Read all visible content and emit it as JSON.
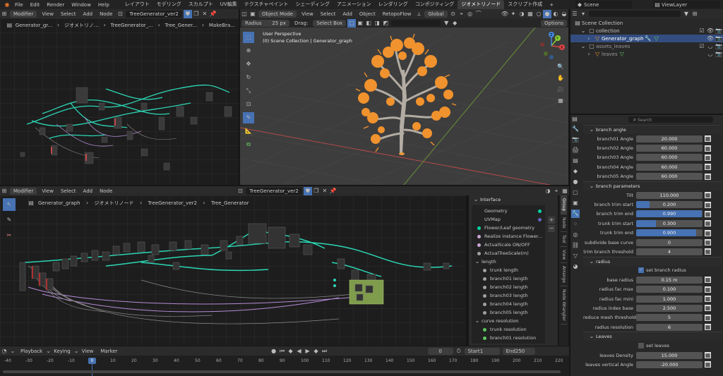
{
  "topbar": {
    "menus": [
      "File",
      "Edit",
      "Render",
      "Window",
      "Help"
    ],
    "workspaces": [
      "レイアウト",
      "モデリング",
      "スカルプト",
      "UV編集",
      "テクスチャペイント",
      "シェーディング",
      "アニメーション",
      "レンダリング",
      "コンポジティング",
      "ジオメトリノード",
      "スクリプト作成"
    ],
    "active_workspace": "ジオメトリノード",
    "add_tab": "+",
    "scene": "Scene",
    "view_layer": "ViewLayer"
  },
  "node_editor_top": {
    "mode": "Modifier",
    "menus": [
      "View",
      "Select",
      "Add",
      "Node"
    ],
    "tree_name": "TreeGenerator_ver2",
    "breadcrumb": [
      "Generator_gr...",
      "ジオメトリノ...",
      "TreeGenerator_...",
      "Tree_Gener...",
      "MakeBra..."
    ]
  },
  "viewport": {
    "mode": "Object Mode",
    "menus": [
      "View",
      "Select",
      "Add",
      "Object",
      "RetopoFlow"
    ],
    "transform": "Global",
    "radius_label": "Radius",
    "radius_value": "25 px",
    "drag_label": "Drag:",
    "drag_value": "Select Box",
    "options": "Options",
    "perspective": "User Perspective",
    "collection_info": "(0) Scene Collection | Generator_graph",
    "axis_x": "X",
    "axis_y": "Y",
    "axis_z": "Z"
  },
  "node_editor_main": {
    "mode": "Modifier",
    "menus": [
      "View",
      "Select",
      "Add",
      "Node"
    ],
    "tree_name": "TreeGenerator_ver2",
    "breadcrumb": [
      "Generator_graph",
      "ジオメトリノード",
      "TreeGenerator_ver2",
      "Tree_Generator"
    ]
  },
  "interface_panel": {
    "title": "Interface",
    "sockets": [
      {
        "label": "Geometry",
        "color": "#00d6a3"
      },
      {
        "label": "UVMap",
        "color": "#6363c7"
      },
      {
        "label": "Flower/Leaf geometry",
        "color": "#00d6a3"
      },
      {
        "label": "Realize instance Flower...",
        "color": "#cca6d6"
      },
      {
        "label": "ActualScale ON/OFF",
        "color": "#cca6d6"
      },
      {
        "label": "ActualTreeScale(m)",
        "color": "#a1a1a1"
      }
    ],
    "group_length": "length",
    "length_items": [
      "trunk length",
      "branch01 length",
      "branch02 length",
      "branch03 length",
      "branch04 length",
      "branch05 length"
    ],
    "group_curve": "curve resolution",
    "curve_items": [
      "trunk resolution",
      "branch01 resolution"
    ],
    "side_tabs": [
      "Group",
      "Node",
      "Tool",
      "View",
      "Arrange",
      "Node Wrangler"
    ]
  },
  "outliner": {
    "search_placeholder": "",
    "items": [
      {
        "label": "Scene Collection",
        "indent": 0
      },
      {
        "label": "collection",
        "indent": 1
      },
      {
        "label": "Generator_graph",
        "indent": 2,
        "selected": true
      },
      {
        "label": "assets_leaves",
        "indent": 1
      },
      {
        "label": "leaves",
        "indent": 2
      }
    ]
  },
  "properties": {
    "search_placeholder": "Search",
    "sections": [
      {
        "title": "branch angle",
        "rows": [
          {
            "label": "branch01 Angle",
            "value": "20.000",
            "fill": 0
          },
          {
            "label": "branch02 Angle",
            "value": "60.000",
            "fill": 0
          },
          {
            "label": "branch03 Angle",
            "value": "60.000",
            "fill": 0
          },
          {
            "label": "branch04 Angle",
            "value": "60.000",
            "fill": 0
          },
          {
            "label": "branch05 Angle",
            "value": "60.000",
            "fill": 0
          }
        ]
      },
      {
        "title": "branch parameters",
        "rows": [
          {
            "label": "Tilt",
            "value": "110.000",
            "fill": 0
          },
          {
            "label": "branch trim start",
            "value": "0.200",
            "fill": 0.2
          },
          {
            "label": "branch trim end",
            "value": "0.990",
            "fill": 0.99
          },
          {
            "label": "trunk trim start",
            "value": "0.300",
            "fill": 0.3
          },
          {
            "label": "trunk trim end",
            "value": "0.900",
            "fill": 0.9
          },
          {
            "label": "subdivide base curve",
            "value": "0",
            "fill": 0
          },
          {
            "label": "trim branch threshold",
            "value": "4",
            "fill": 0
          }
        ]
      },
      {
        "title": "radius",
        "checkbox": "set branch  radius",
        "rows": [
          {
            "label": "base radius",
            "value": "0.15 m",
            "fill": 0
          },
          {
            "label": "radius fac max",
            "value": "0.100",
            "fill": 0
          },
          {
            "label": "radius fac mini",
            "value": "1.000",
            "fill": 0
          },
          {
            "label": "radius index base",
            "value": "2.500",
            "fill": 0
          },
          {
            "label": "reduce mesh threshold",
            "value": "5",
            "fill": 0
          },
          {
            "label": "radius resolution",
            "value": "6",
            "fill": 0
          }
        ]
      },
      {
        "title": "Leaves",
        "checkbox": "set leaves",
        "rows": [
          {
            "label": "leaves Density",
            "value": "15.000",
            "fill": 0
          },
          {
            "label": "leaves vertical Angle",
            "value": "-20.000",
            "fill": 0
          }
        ]
      }
    ]
  },
  "timeline": {
    "menus": [
      "Playback",
      "Keying",
      "View",
      "Marker"
    ],
    "current_frame": "0",
    "start_label": "Start",
    "start": "1",
    "end_label": "End",
    "end": "250",
    "ticks": [
      "-40",
      "-30",
      "-20",
      "-10",
      "0",
      "10",
      "20",
      "30",
      "40",
      "50",
      "60",
      "70",
      "80",
      "90",
      "100",
      "110",
      "120",
      "130",
      "140",
      "150",
      "160",
      "170",
      "180",
      "190",
      "200",
      "210",
      "220"
    ],
    "playhead": "0"
  },
  "colors": {
    "accent": "#4772b3",
    "trunk": "#b3aca3",
    "leaves": "#f0922e",
    "wire_teal": "#2bd6b4",
    "wire_purple": "#b58cd6"
  }
}
